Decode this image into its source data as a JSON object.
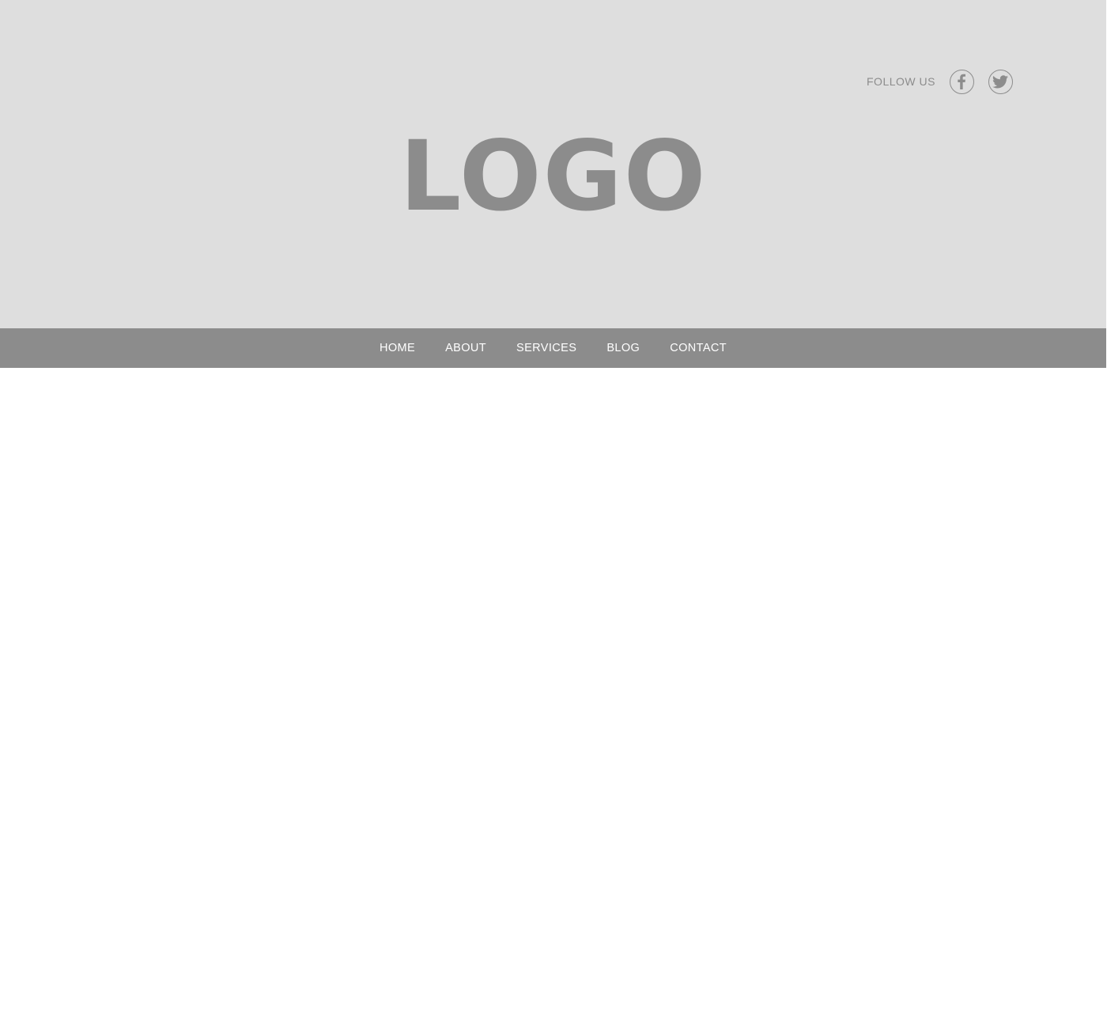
{
  "header": {
    "background_color": "#dedede",
    "follow_label": "FOLLOW US",
    "social": [
      {
        "icon": "facebook-icon"
      },
      {
        "icon": "twitter-icon"
      }
    ],
    "logo_text": "LOGO"
  },
  "nav": {
    "background_color": "#8c8c8c",
    "items": [
      {
        "label": "HOME"
      },
      {
        "label": "ABOUT"
      },
      {
        "label": "SERVICES"
      },
      {
        "label": "BLOG"
      },
      {
        "label": "CONTACT"
      }
    ]
  },
  "colors": {
    "accent_gray": "#8c8c8c",
    "text_on_nav": "#ffffff",
    "page_background": "#ffffff"
  }
}
